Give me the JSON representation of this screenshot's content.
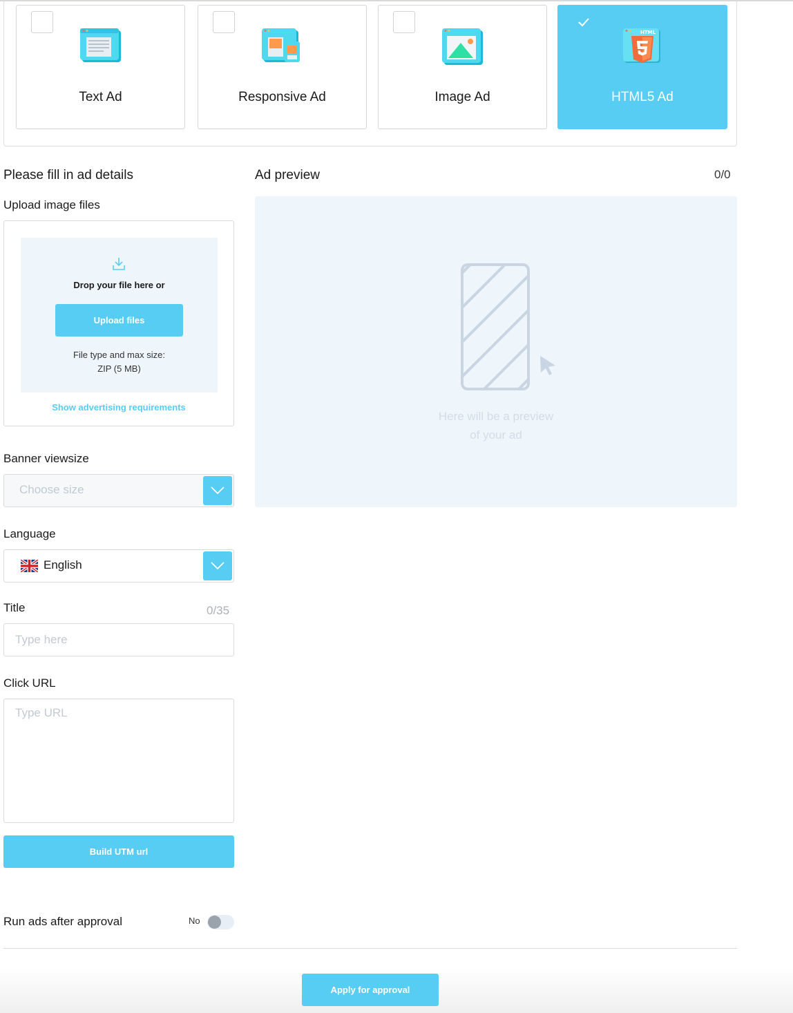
{
  "ad_types": [
    {
      "label": "Text Ad",
      "selected": false,
      "icon": "text-ad-icon"
    },
    {
      "label": "Responsive Ad",
      "selected": false,
      "icon": "responsive-ad-icon"
    },
    {
      "label": "Image Ad",
      "selected": false,
      "icon": "image-ad-icon"
    },
    {
      "label": "HTML5 Ad",
      "selected": true,
      "icon": "html5-ad-icon",
      "icon_text": "HTML"
    }
  ],
  "form": {
    "title": "Please fill in ad details",
    "upload": {
      "label": "Upload image files",
      "drop_text": "Drop your file here or",
      "button_label": "Upload files",
      "file_type_label": "File type and max size:",
      "file_type_value": "ZIP (5 MB)",
      "requirements_link": "Show advertising requirements"
    },
    "banner_size": {
      "label": "Banner viewsize",
      "placeholder": "Choose size"
    },
    "language": {
      "label": "Language",
      "value": "English",
      "flag": "uk-flag-icon"
    },
    "title_field": {
      "label": "Title",
      "counter": "0/35",
      "placeholder": "Type here"
    },
    "click_url": {
      "label": "Click URL",
      "placeholder": "Type URL"
    },
    "utm_button": "Build UTM url",
    "run_after_approval": {
      "label": "Run ads after approval",
      "state": "No"
    }
  },
  "preview": {
    "title": "Ad preview",
    "counter": "0/0",
    "placeholder_line1": "Here will be a preview",
    "placeholder_line2": "of your ad"
  },
  "footer": {
    "apply_button": "Apply for approval"
  },
  "colors": {
    "accent": "#58cdf3",
    "preview_bg": "#eef5fb",
    "border": "#d6dade"
  }
}
